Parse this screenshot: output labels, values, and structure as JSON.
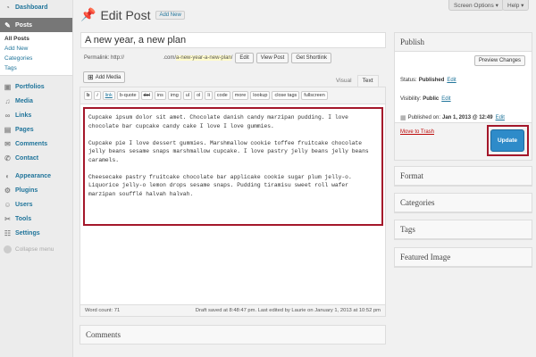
{
  "top_buttons": {
    "screen_options": "Screen Options ▾",
    "help": "Help ▾"
  },
  "sidebar": {
    "items": [
      {
        "label": "Dashboard",
        "icon": "dashboard-icon"
      },
      {
        "label": "Posts",
        "icon": "posts-icon",
        "active": true
      },
      {
        "label": "Portfolios",
        "icon": "portfolios-icon"
      },
      {
        "label": "Media",
        "icon": "media-icon"
      },
      {
        "label": "Links",
        "icon": "links-icon"
      },
      {
        "label": "Pages",
        "icon": "pages-icon"
      },
      {
        "label": "Comments",
        "icon": "comments-icon"
      },
      {
        "label": "Contact",
        "icon": "contact-icon"
      },
      {
        "label": "Appearance",
        "icon": "appearance-icon"
      },
      {
        "label": "Plugins",
        "icon": "plugins-icon"
      },
      {
        "label": "Users",
        "icon": "users-icon"
      },
      {
        "label": "Tools",
        "icon": "tools-icon"
      },
      {
        "label": "Settings",
        "icon": "settings-icon"
      }
    ],
    "posts_submenu": [
      "All Posts",
      "Add New",
      "Categories",
      "Tags"
    ],
    "collapse": "Collapse menu"
  },
  "header": {
    "title": "Edit Post",
    "add_new": "Add New"
  },
  "post": {
    "title": "A new year, a new plan",
    "permalink_label": "Permalink: http://",
    "permalink_blank": "                          ",
    "permalink_base": ".com/",
    "permalink_slug": "a-new-year-a-new-plan",
    "permalink_end": "/",
    "buttons": [
      "Edit",
      "View Post",
      "Get Shortlink"
    ]
  },
  "editor": {
    "add_media": "Add Media",
    "tab_visual": "Visual",
    "tab_text": "Text",
    "quicktags": [
      "b",
      "i",
      "link",
      "b-quote",
      "del",
      "ins",
      "img",
      "ul",
      "ol",
      "li",
      "code",
      "more",
      "lookup",
      "close tags",
      "fullscreen"
    ],
    "paragraphs": [
      "Cupcake ipsum dolor sit amet. Chocolate danish candy marzipan pudding. I love chocolate bar cupcake candy cake I love I love gummies.",
      "Cupcake pie I love dessert gummies. Marshmallow cookie toffee fruitcake chocolate jelly beans sesame snaps marshmallow cupcake. I love pastry jelly beans jelly beans caramels.",
      "Cheesecake pastry fruitcake chocolate bar applicake cookie sugar plum jelly-o. Liquorice jelly-o lemon drops sesame snaps. Pudding tiramisu sweet roll wafer marzipan soufflé halvah halvah."
    ],
    "word_count": "Word count: 71",
    "draft_status": "Draft saved at 8:48:47 pm. Last edited by Laurie on January 1, 2013 at 10:52 pm"
  },
  "comments_box": {
    "title": "Comments"
  },
  "publish": {
    "title": "Publish",
    "preview_button": "Preview Changes",
    "status_label": "Status:",
    "status_value": "Published",
    "visibility_label": "Visibility:",
    "visibility_value": "Public",
    "published_label": "Published on:",
    "published_value": "Jan 1, 2013 @ 12:49",
    "edit": "Edit",
    "trash": "Move to Trash",
    "update": "Update"
  },
  "side_boxes": {
    "format": "Format",
    "categories": "Categories",
    "tags": "Tags",
    "featured_image": "Featured Image"
  }
}
